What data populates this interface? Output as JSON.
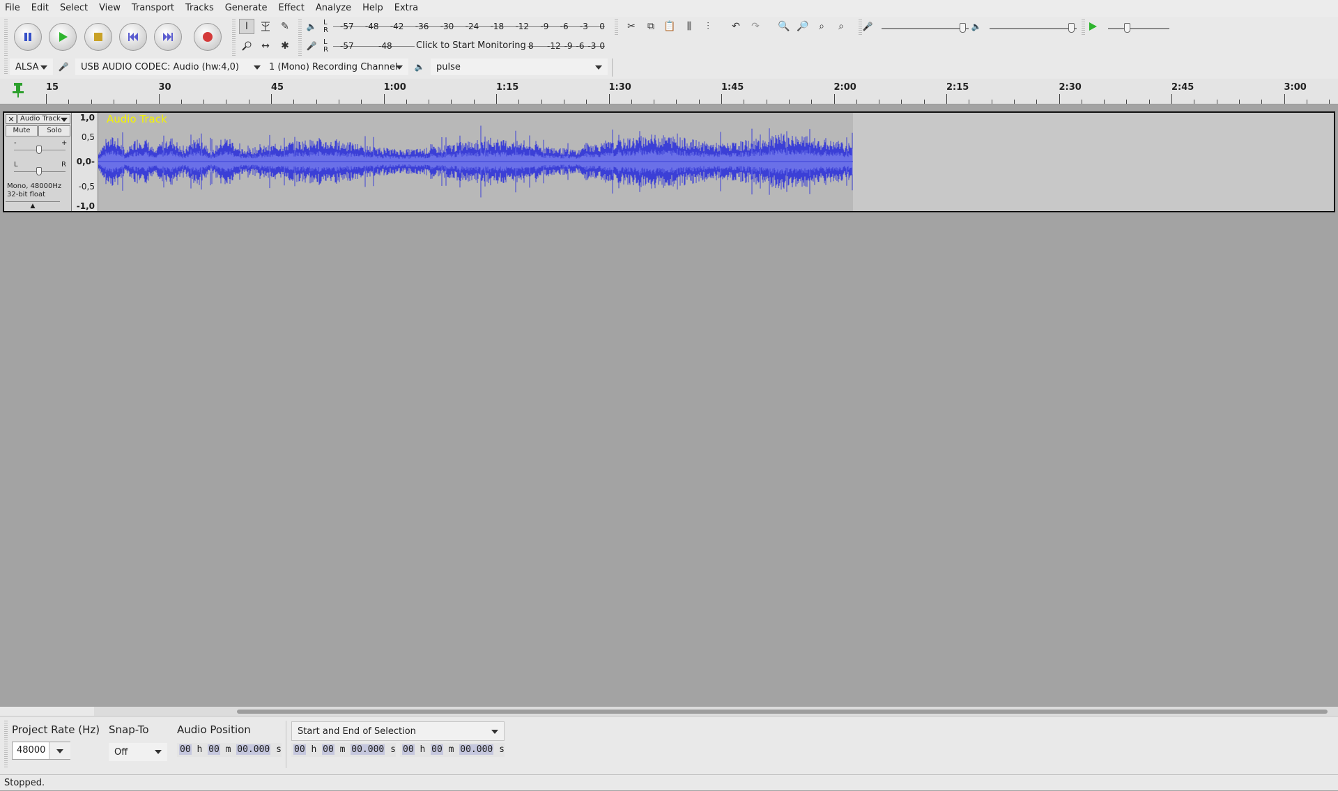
{
  "menu": [
    "File",
    "Edit",
    "Select",
    "View",
    "Transport",
    "Tracks",
    "Generate",
    "Effect",
    "Analyze",
    "Help",
    "Extra"
  ],
  "meters": {
    "playback_scale": [
      "-57",
      "-48",
      "-42",
      "-36",
      "-30",
      "-24",
      "-18",
      "-12",
      "-9",
      "-6",
      "-3",
      "0"
    ],
    "record_scale": [
      "-57",
      "-48",
      "-12",
      "-9",
      "-6",
      "-3",
      "0"
    ],
    "record_prompt": "Click to Start Monitoring",
    "record_prompt_suffix": "8"
  },
  "devices": {
    "host": "ALSA",
    "recording_device": "USB AUDIO  CODEC: Audio (hw:4,0)",
    "channels": "1 (Mono) Recording Channel",
    "playback_device": "pulse"
  },
  "ruler": {
    "labels": [
      "15",
      "30",
      "45",
      "1:00",
      "1:15",
      "1:30",
      "1:45",
      "2:00",
      "2:15",
      "2:30",
      "2:45",
      "3:00"
    ]
  },
  "track": {
    "name": "Audio Track",
    "title_overlay": "Audio Track",
    "mute": "Mute",
    "solo": "Solo",
    "format_line1": "Mono, 48000Hz",
    "format_line2": "32-bit float",
    "gain_minus": "-",
    "gain_plus": "+",
    "pan_left": "L",
    "pan_right": "R",
    "scale": [
      "1,0",
      "0,5",
      "0,0-",
      "-0,5",
      "-1,0"
    ],
    "wave_color": "#3b3fd6",
    "wave_inner_color": "#6a70e8",
    "audio_end_fraction": 0.6111
  },
  "bottom": {
    "project_rate_label": "Project Rate (Hz)",
    "project_rate_value": "48000",
    "snap_to_label": "Snap-To",
    "snap_to_value": "Off",
    "audio_position_label": "Audio Position",
    "selection_mode": "Start and End of Selection",
    "time_hh": "00",
    "time_h": "h",
    "time_mm": "00",
    "time_m": "m",
    "time_ss": "00.000",
    "time_s": "s"
  },
  "status": "Stopped."
}
